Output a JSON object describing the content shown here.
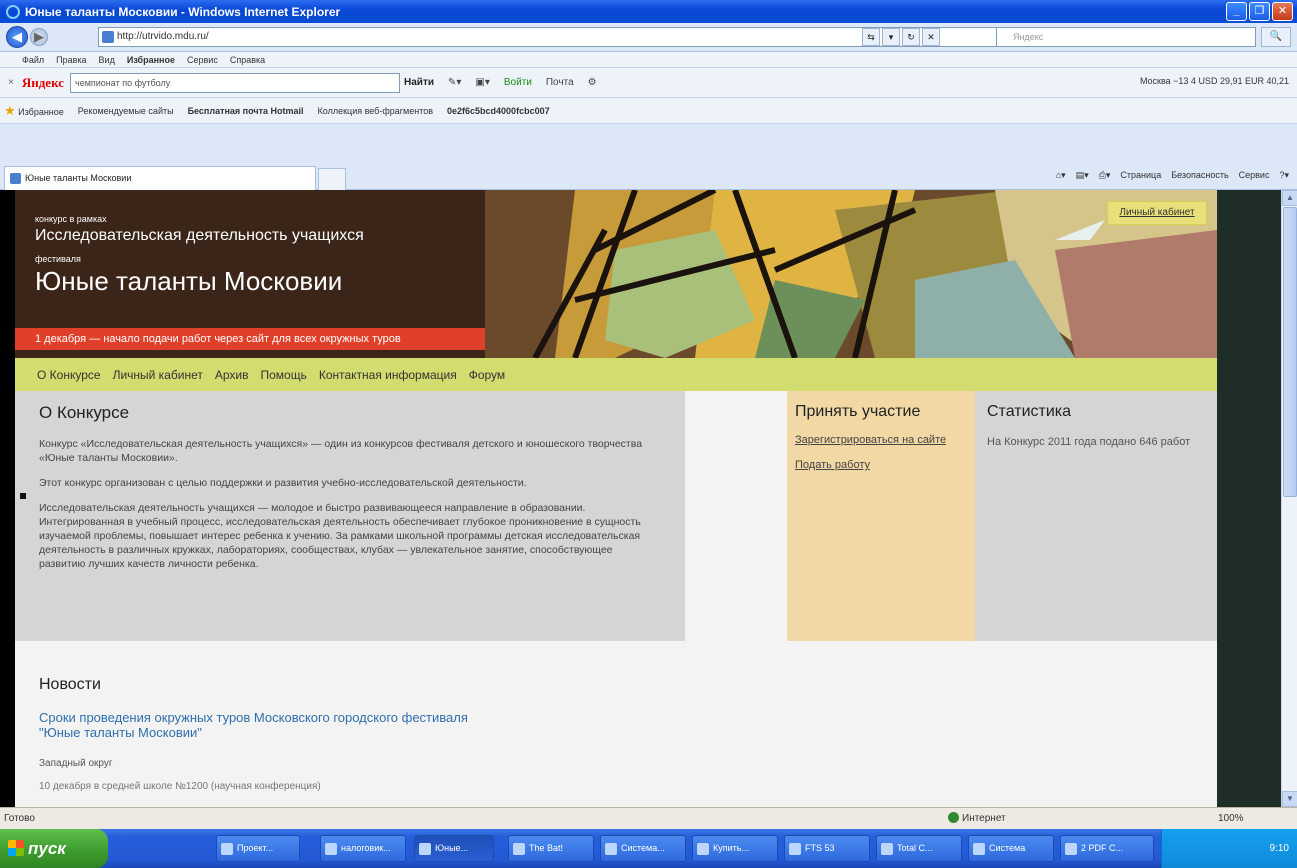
{
  "window": {
    "title": "Юные таланты Московии - Windows Internet Explorer",
    "url": "http://utrvido.mdu.ru/",
    "search_placeholder": "Яндекс"
  },
  "menu": [
    "Файл",
    "Правка",
    "Вид",
    "Избранное",
    "Сервис",
    "Справка"
  ],
  "yandex_bar": {
    "logo": "Яндекс",
    "input_value": "чемпионат по футболу",
    "find_label": "Найти",
    "login_label": "Войти",
    "mail_label": "Почта",
    "weather": "Москва  −13  4  USD 29,91  EUR 40,21"
  },
  "favorites": {
    "label": "Избранное",
    "items": [
      "Рекомендуемые сайты",
      "Бесплатная почта Hotmail",
      "Коллекция веб-фрагментов",
      "0e2f6c5bcd4000fcbc007"
    ]
  },
  "tab": {
    "active_label": "Юные таланты Московии"
  },
  "command_bar": [
    "Страница",
    "Безопасность",
    "Сервис"
  ],
  "banner": {
    "kicker1": "конкурс в рамках",
    "heading1": "Исследовательская деятельность учащихся",
    "kicker2": "фестиваля",
    "heading2": "Юные таланты Московии",
    "deadline": "1 декабря — начало подачи работ через сайт для всех окружных туров",
    "cabinet_link": "Личный кабинет"
  },
  "nav": [
    "О Конкурсе",
    "Личный кабинет",
    "Архив",
    "Помощь",
    "Контактная информация",
    "Форум"
  ],
  "about": {
    "title": "О Конкурсе",
    "p1": "Конкурс «Исследовательская деятельность учащихся» — один из конкурсов фестиваля детского и юношеского творчества «Юные таланты Московии».",
    "p2": "Этот конкурс организован с целью поддержки и развития учебно-исследовательской деятельности.",
    "p3": "Исследовательская деятельность учащихся — молодое и быстро развивающееся направление в образовании. Интегрированная в учебный процесс, исследовательская деятельность обеспечивает глубокое проникновение в сущность изучаемой проблемы, повышает интерес ребенка к учению. За рамками школьной программы детская исследовательская деятельность в различных кружках, лабораториях, сообществах, клубах — увлекательное занятие, способствующее развитию лучших качеств личности ребенка."
  },
  "participate": {
    "title": "Принять участие",
    "register_link": "Зарегистрироваться на сайте",
    "submit_link": "Подать работу"
  },
  "stats": {
    "title": "Статистика",
    "text": "На Конкурс 2011 года подано 646 работ"
  },
  "news": {
    "title": "Новости",
    "link": "Сроки проведения окружных туров Московского городского фестиваля \"Юные таланты Московии\"",
    "district": "Западный округ",
    "cut": "10 декабря в средней школе №1200 (научная конференция)"
  },
  "status": {
    "text": "Готово",
    "zone": "Интернет",
    "zoom": "100%"
  },
  "taskbar": {
    "start_label": "пуск",
    "items": [
      "Проект...",
      "налоговик...",
      "Юные...",
      "The Bat!",
      "Система...",
      "Купить...",
      "FTS 53",
      "Total C...",
      "Система",
      "2 PDF C..."
    ],
    "clock": "9:10"
  }
}
